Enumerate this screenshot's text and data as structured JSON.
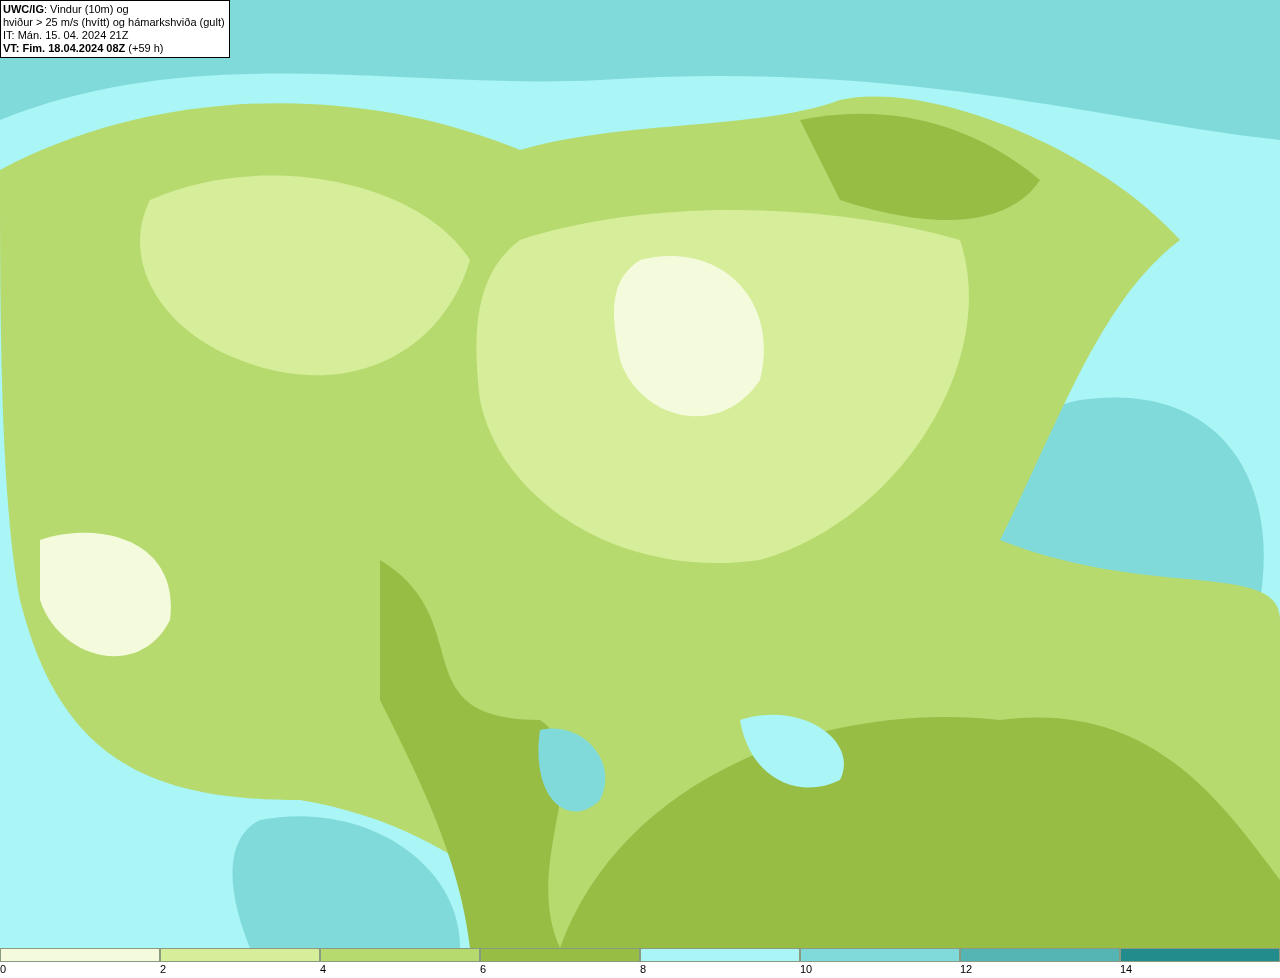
{
  "title_box": {
    "lines": [
      "**UWC/IG**: Vindur (10m) og",
      "hviður > 25 m/s (hvítt) og hámarkshviða (gult)",
      "IT: Mán. 15. 04. 2024 21Z",
      "**VT: Fim. 18.04.2024 08Z** (+59 h)"
    ]
  },
  "legend": {
    "bins": [
      {
        "color": "#f4fadc",
        "label": "0"
      },
      {
        "color": "#d6ee9a",
        "label": "2"
      },
      {
        "color": "#b6da6e",
        "label": "4"
      },
      {
        "color": "#97bd45",
        "label": "6"
      },
      {
        "color": "#aaf5f5",
        "label": "8"
      },
      {
        "color": "#80dada",
        "label": "10"
      },
      {
        "color": "#55b4b4",
        "label": "12"
      },
      {
        "color": "#228c8c",
        "label": "14"
      }
    ]
  }
}
